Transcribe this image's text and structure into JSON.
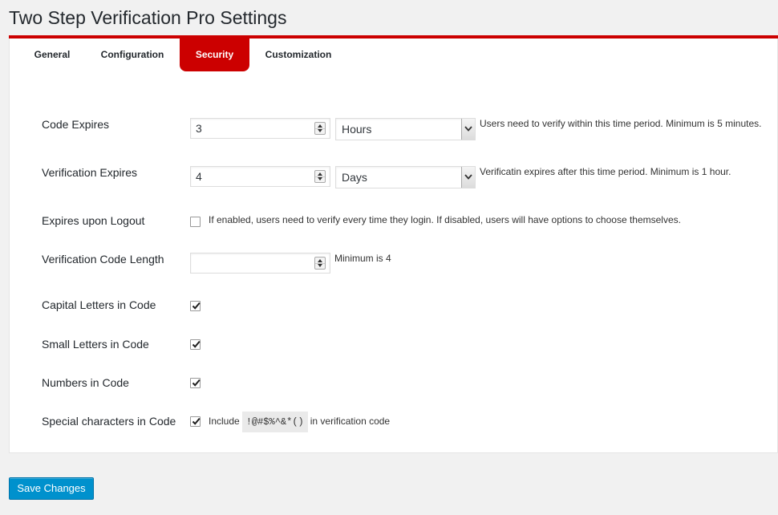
{
  "page": {
    "title": "Two Step Verification Pro Settings"
  },
  "tabs": [
    {
      "label": "General"
    },
    {
      "label": "Configuration"
    },
    {
      "label": "Security",
      "active": true
    },
    {
      "label": "Customization"
    }
  ],
  "colors": {
    "accent": "#cc0000",
    "button": "#0091cd"
  },
  "settings": {
    "code_expires": {
      "label": "Code Expires",
      "value": "3",
      "unit": "Hours",
      "description": "Users need to verify within this time period. Minimum is 5 minutes."
    },
    "verification_expires": {
      "label": "Verification Expires",
      "value": "4",
      "unit": "Days",
      "description": "Verificatin expires after this time period. Minimum is 1 hour."
    },
    "expires_on_logout": {
      "label": "Expires upon Logout",
      "checked": false,
      "description": "If enabled, users need to verify every time they login. If disabled, users will have options to choose themselves."
    },
    "code_length": {
      "label": "Verification Code Length",
      "value": "",
      "description": "Minimum is 4"
    },
    "capital_letters": {
      "label": "Capital Letters in Code",
      "checked": true
    },
    "small_letters": {
      "label": "Small Letters in Code",
      "checked": true
    },
    "numbers": {
      "label": "Numbers in Code",
      "checked": true
    },
    "special_chars": {
      "label": "Special characters in Code",
      "checked": true,
      "desc_prefix": "Include",
      "chars": "!@#$%^&*()",
      "desc_suffix": "in verification code"
    }
  },
  "actions": {
    "save_label": "Save Changes"
  }
}
